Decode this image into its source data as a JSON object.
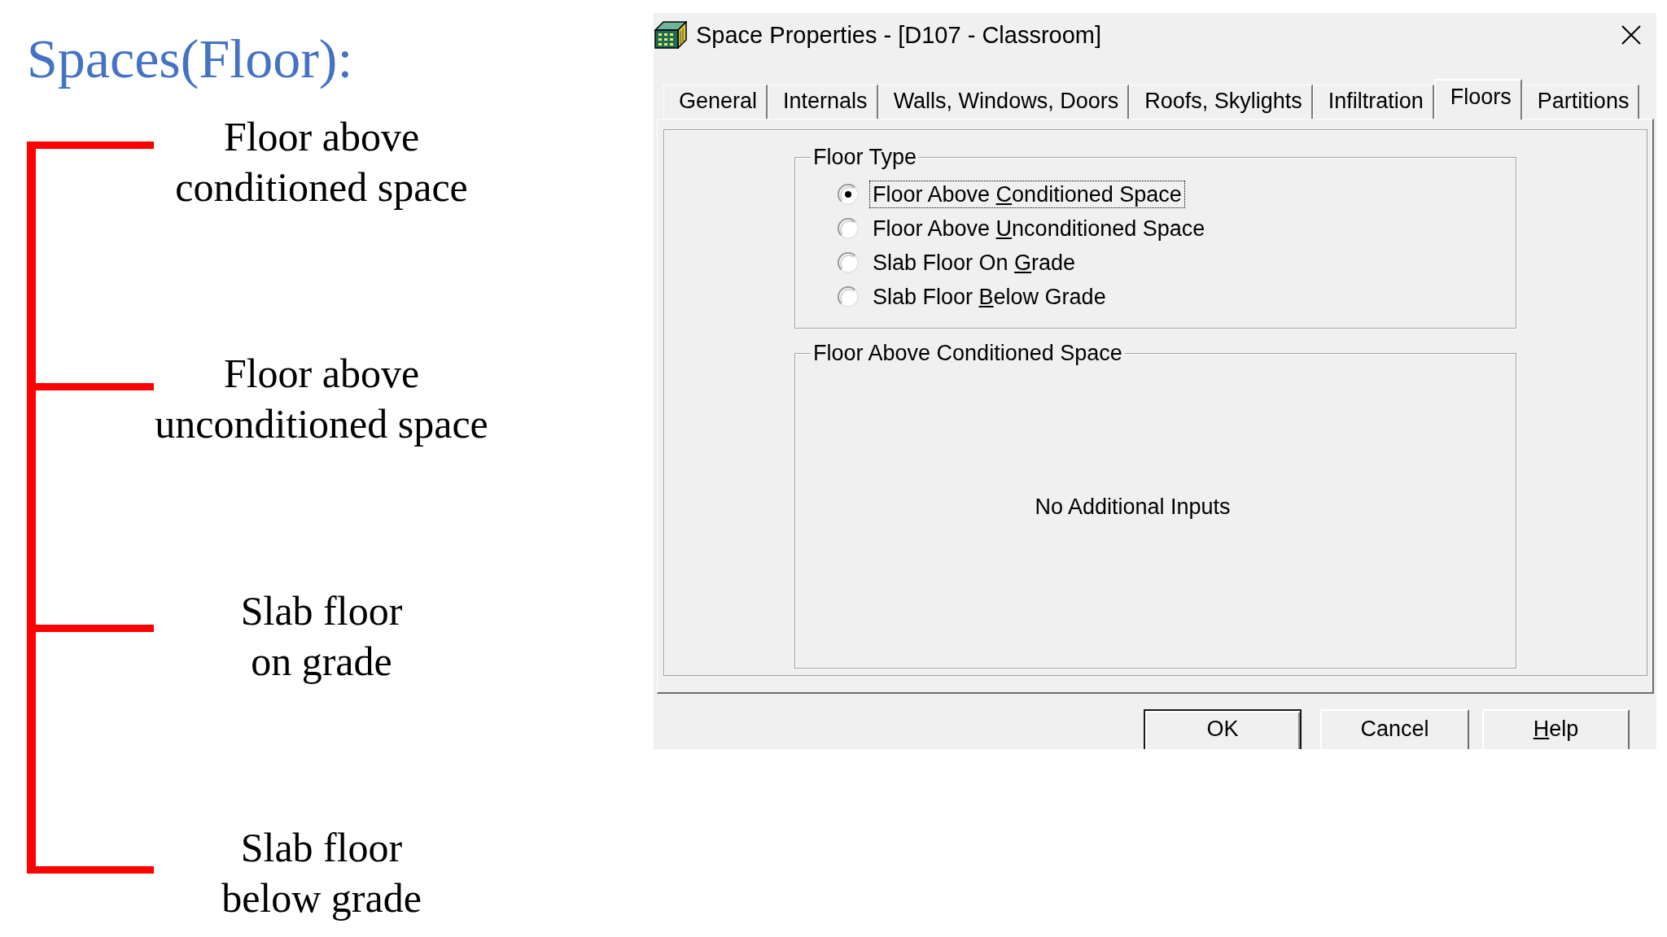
{
  "slide": {
    "title": "Spaces(Floor):",
    "labels": [
      {
        "lines": [
          "Floor above",
          "conditioned space"
        ]
      },
      {
        "lines": [
          "Floor above",
          "unconditioned space"
        ]
      },
      {
        "lines": [
          "Slab floor",
          "on grade"
        ]
      },
      {
        "lines": [
          "Slab floor",
          "below grade"
        ]
      }
    ]
  },
  "dialog": {
    "title": "Space Properties - [D107 - Classroom]",
    "tabs": [
      {
        "label": "General",
        "selected": false
      },
      {
        "label": "Internals",
        "selected": false
      },
      {
        "label": "Walls, Windows, Doors",
        "selected": false
      },
      {
        "label": "Roofs, Skylights",
        "selected": false
      },
      {
        "label": "Infiltration",
        "selected": false
      },
      {
        "label": "Floors",
        "selected": true
      },
      {
        "label": "Partitions",
        "selected": false
      }
    ],
    "floor_type": {
      "legend": "Floor Type",
      "options": [
        {
          "label_parts": [
            {
              "text": "Floor Above ",
              "underlined": false
            },
            {
              "text": "C",
              "underlined": true
            },
            {
              "text": "onditioned Space",
              "underlined": false
            }
          ],
          "selected": true,
          "focused": true
        },
        {
          "label_parts": [
            {
              "text": "Floor Above ",
              "underlined": false
            },
            {
              "text": "U",
              "underlined": true
            },
            {
              "text": "nconditioned Space",
              "underlined": false
            }
          ],
          "selected": false,
          "focused": false
        },
        {
          "label_parts": [
            {
              "text": "Slab Floor On ",
              "underlined": false
            },
            {
              "text": "G",
              "underlined": true
            },
            {
              "text": "rade",
              "underlined": false
            }
          ],
          "selected": false,
          "focused": false
        },
        {
          "label_parts": [
            {
              "text": "Slab Floor ",
              "underlined": false
            },
            {
              "text": "B",
              "underlined": true
            },
            {
              "text": "elow Grade",
              "underlined": false
            }
          ],
          "selected": false,
          "focused": false
        }
      ]
    },
    "details": {
      "legend": "Floor Above Conditioned Space",
      "message": "No Additional Inputs"
    },
    "buttons": [
      {
        "label_parts": [
          {
            "text": "OK",
            "underlined": false
          }
        ],
        "default": true
      },
      {
        "label_parts": [
          {
            "text": "Cancel",
            "underlined": false
          }
        ],
        "default": false
      },
      {
        "label_parts": [
          {
            "text": "H",
            "underlined": true
          },
          {
            "text": "elp",
            "underlined": false
          }
        ],
        "default": false
      }
    ]
  }
}
